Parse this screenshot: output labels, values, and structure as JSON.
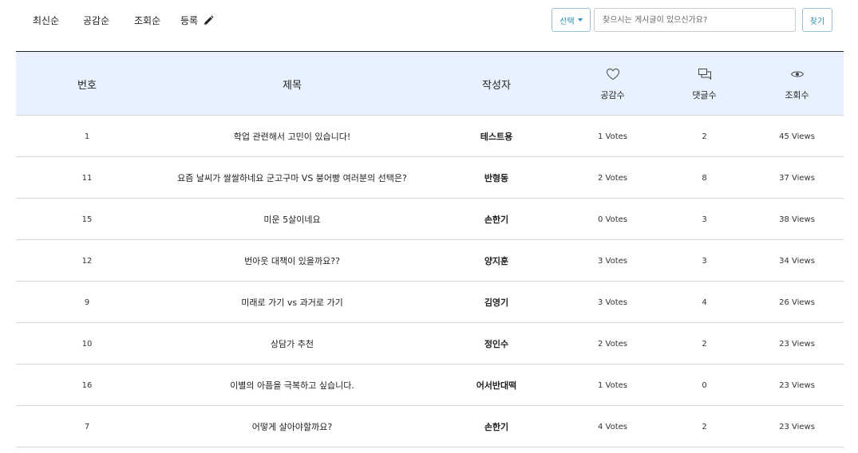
{
  "nav": {
    "sort_latest": "최신순",
    "sort_likes": "공감순",
    "sort_views": "조회순",
    "write": "등록"
  },
  "search": {
    "select_label": "선택",
    "placeholder": "찾으시는 게시글이 있으신가요?",
    "button_label": "찾기"
  },
  "table": {
    "headers": {
      "number": "번호",
      "title": "제목",
      "author": "작성자",
      "votes": "공감수",
      "comments": "댓글수",
      "views": "조회수"
    },
    "rows": [
      {
        "number": "1",
        "title": "학업 관련해서 고민이 있습니다!",
        "author": "테스트용",
        "votes": "1 Votes",
        "comments": "2",
        "views": "45 Views"
      },
      {
        "number": "11",
        "title": "요즘 날씨가 쌀쌀하네요 군고구마 VS 붕어빵 여러분의 선택은?",
        "author": "반형동",
        "votes": "2 Votes",
        "comments": "8",
        "views": "37 Views"
      },
      {
        "number": "15",
        "title": "미운 5살이네요",
        "author": "손한기",
        "votes": "0 Votes",
        "comments": "3",
        "views": "38 Views"
      },
      {
        "number": "12",
        "title": "번아웃 대책이 있을까요??",
        "author": "양지훈",
        "votes": "3 Votes",
        "comments": "3",
        "views": "34 Views"
      },
      {
        "number": "9",
        "title": "미래로 가기 vs 과거로 가기",
        "author": "김영기",
        "votes": "3 Votes",
        "comments": "4",
        "views": "26 Views"
      },
      {
        "number": "10",
        "title": "상담가 추천",
        "author": "정인수",
        "votes": "2 Votes",
        "comments": "2",
        "views": "23 Views"
      },
      {
        "number": "16",
        "title": "이별의 아픔을 극복하고 싶습니다.",
        "author": "어서반대떡",
        "votes": "1 Votes",
        "comments": "0",
        "views": "23 Views"
      },
      {
        "number": "7",
        "title": "어떻게 살아야할까요?",
        "author": "손한기",
        "votes": "4 Votes",
        "comments": "2",
        "views": "23 Views"
      }
    ]
  },
  "icons": {
    "write": "pencil-icon",
    "votes": "heart-icon",
    "comments": "comments-icon",
    "views": "eye-icon"
  },
  "colors": {
    "header_bg": "#e8f2fe",
    "accent": "#2f8fb0",
    "border": "#d8d8d8"
  }
}
